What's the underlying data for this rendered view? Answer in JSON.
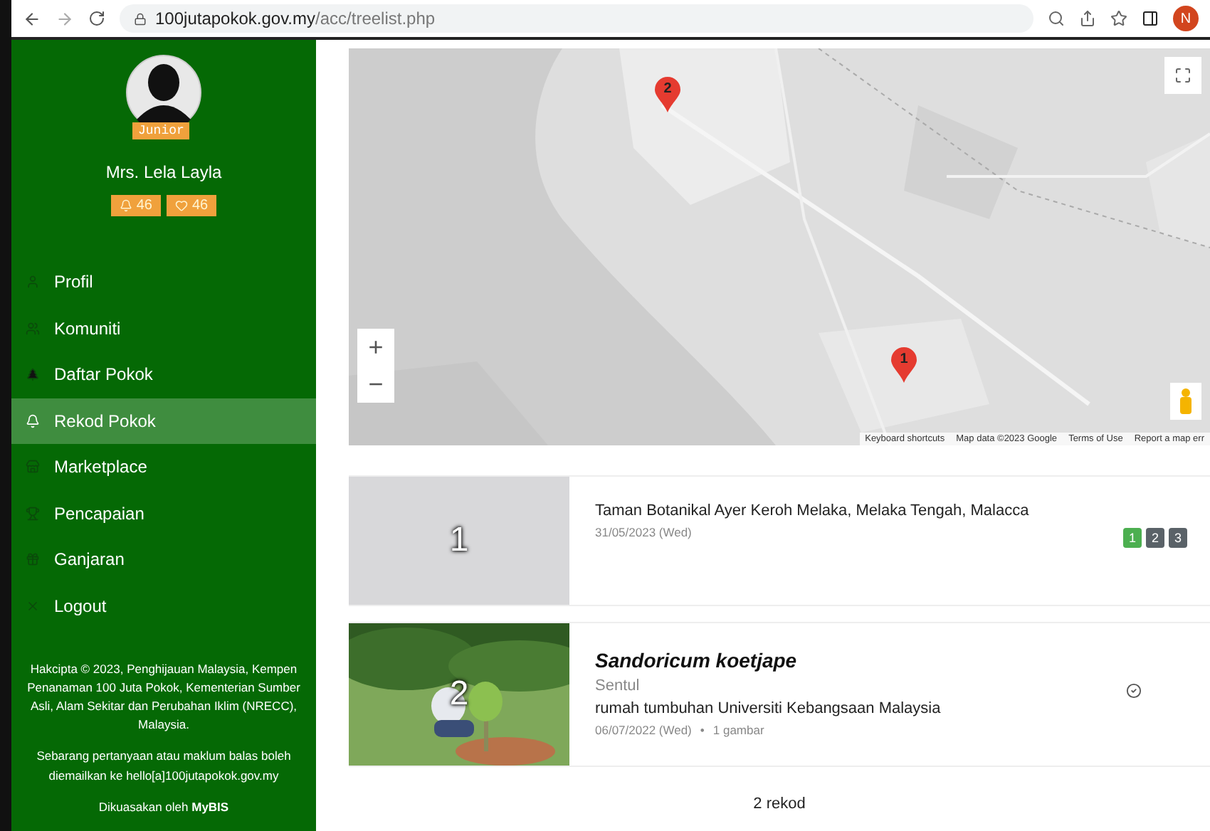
{
  "browser": {
    "url_host": "100jutapokok.gov.my",
    "url_path": "/acc/treelist.php",
    "profile_initial": "N"
  },
  "sidebar": {
    "level_badge": "Junior",
    "user_name": "Mrs. Lela Layla",
    "counters": [
      {
        "kind": "bell",
        "value": "46"
      },
      {
        "kind": "heart",
        "value": "46"
      }
    ],
    "items": [
      {
        "label": "Profil",
        "selected": false
      },
      {
        "label": "Komuniti",
        "selected": false
      },
      {
        "label": "Daftar Pokok",
        "selected": false
      },
      {
        "label": "Rekod Pokok",
        "selected": true
      },
      {
        "label": "Marketplace",
        "selected": false
      },
      {
        "label": "Pencapaian",
        "selected": false
      },
      {
        "label": "Ganjaran",
        "selected": false
      },
      {
        "label": "Logout",
        "selected": false
      }
    ],
    "footer": [
      "Hakcipta © 2023, Penghijauan Malaysia, Kempen Penanaman 100 Juta Pokok, Kementerian Sumber Asli, Alam Sekitar dan Perubahan Iklim (NRECC), Malaysia.",
      "Sebarang pertanyaan atau maklum balas boleh diemailkan ke hello[a]100jutapokok.gov.my",
      "Dikuasakan oleh **MyBIS**"
    ]
  },
  "map": {
    "markers": [
      {
        "label": "2"
      },
      {
        "label": "1"
      }
    ],
    "zoom_in": "+",
    "zoom_out": "−",
    "attribution": [
      "Keyboard shortcuts",
      "Map data ©2023 Google",
      "Terms of Use",
      "Report a map err"
    ]
  },
  "records": [
    {
      "kind": "placeholder",
      "number": "1",
      "title": "Taman Botanikal Ayer Keroh Melaka, Melaka Tengah, Malacca",
      "date": "31/05/2023 (Wed)",
      "pages": [
        {
          "label": "1",
          "selected": true
        },
        {
          "label": "2",
          "selected": false
        },
        {
          "label": "3",
          "selected": false
        }
      ]
    },
    {
      "number": "2",
      "species": "Sandoricum koetjape",
      "local_name": "Sentul",
      "place": "rumah tumbuhan Universiti Kebangsaan Malaysia",
      "date": "06/07/2022 (Wed)",
      "separator": "•",
      "photos": "1 gambar",
      "verified": true
    }
  ],
  "total": "2 rekod"
}
